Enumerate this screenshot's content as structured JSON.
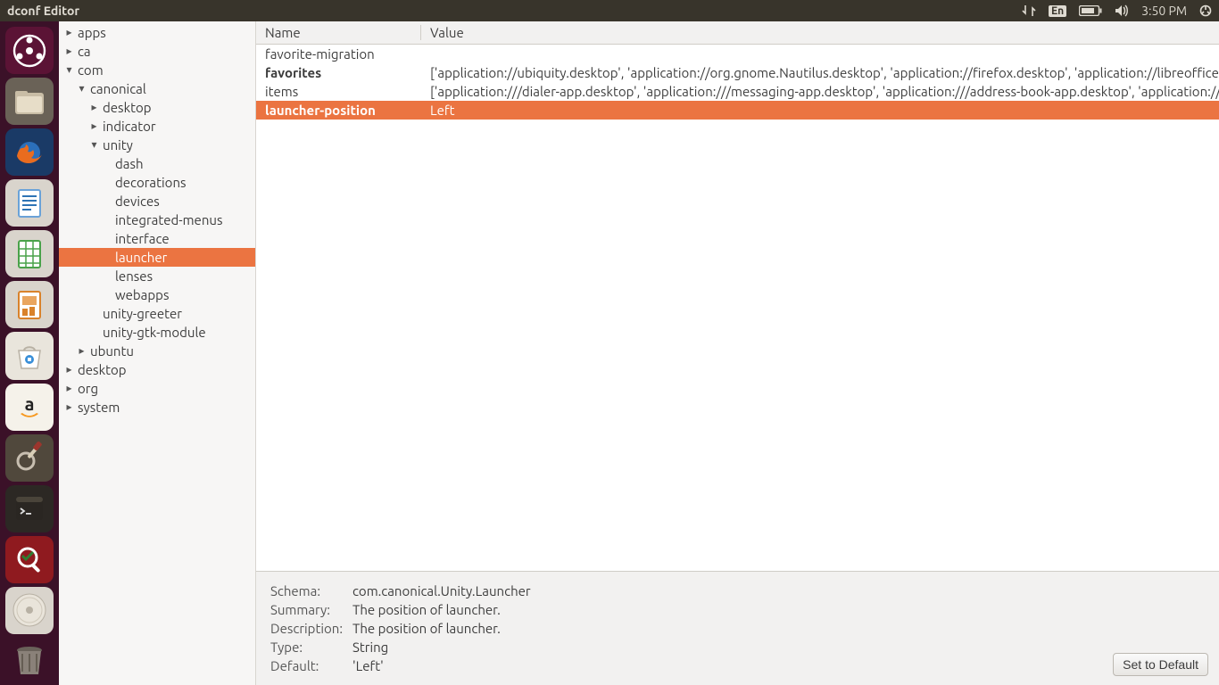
{
  "menubar": {
    "title": "dconf Editor",
    "lang": "En",
    "time": "3:50 PM"
  },
  "launcher_items": [
    {
      "name": "dash",
      "bg": "#5b1335"
    },
    {
      "name": "files",
      "bg": "#6a6257"
    },
    {
      "name": "firefox",
      "bg": "#1a3a66"
    },
    {
      "name": "writer",
      "bg": "#d9d4cc"
    },
    {
      "name": "calc",
      "bg": "#d9d4cc"
    },
    {
      "name": "impress",
      "bg": "#d9d4cc"
    },
    {
      "name": "software",
      "bg": "#e9e5dc"
    },
    {
      "name": "amazon",
      "bg": "#f5f2ea"
    },
    {
      "name": "settings",
      "bg": "#50483c"
    },
    {
      "name": "terminal",
      "bg": "#2c2824"
    },
    {
      "name": "dconf",
      "bg": "#8f1a1f"
    },
    {
      "name": "disk",
      "bg": "#d9d4cc"
    },
    {
      "name": "trash",
      "bg": "transparent"
    }
  ],
  "tree": [
    {
      "depth": 0,
      "exp": "right",
      "label": "apps"
    },
    {
      "depth": 0,
      "exp": "right",
      "label": "ca"
    },
    {
      "depth": 0,
      "exp": "down",
      "label": "com"
    },
    {
      "depth": 1,
      "exp": "down",
      "label": "canonical"
    },
    {
      "depth": 2,
      "exp": "right",
      "label": "desktop"
    },
    {
      "depth": 2,
      "exp": "right",
      "label": "indicator"
    },
    {
      "depth": 2,
      "exp": "down",
      "label": "unity"
    },
    {
      "depth": 3,
      "exp": "none",
      "label": "dash"
    },
    {
      "depth": 3,
      "exp": "none",
      "label": "decorations"
    },
    {
      "depth": 3,
      "exp": "none",
      "label": "devices"
    },
    {
      "depth": 3,
      "exp": "none",
      "label": "integrated-menus"
    },
    {
      "depth": 3,
      "exp": "none",
      "label": "interface"
    },
    {
      "depth": 3,
      "exp": "none",
      "label": "launcher",
      "sel": true
    },
    {
      "depth": 3,
      "exp": "none",
      "label": "lenses"
    },
    {
      "depth": 3,
      "exp": "none",
      "label": "webapps"
    },
    {
      "depth": 2,
      "exp": "none",
      "label": "unity-greeter"
    },
    {
      "depth": 2,
      "exp": "none",
      "label": "unity-gtk-module"
    },
    {
      "depth": 1,
      "exp": "right",
      "label": "ubuntu"
    },
    {
      "depth": 0,
      "exp": "right",
      "label": "desktop"
    },
    {
      "depth": 0,
      "exp": "right",
      "label": "org"
    },
    {
      "depth": 0,
      "exp": "right",
      "label": "system"
    }
  ],
  "columns": {
    "name": "Name",
    "value": "Value"
  },
  "rows": [
    {
      "name": "favorite-migration",
      "value": "",
      "bold": false
    },
    {
      "name": "favorites",
      "value": "['application://ubiquity.desktop', 'application://org.gnome.Nautilus.desktop', 'application://firefox.desktop', 'application://libreoffice-writer.desktop', ...]",
      "bold": true
    },
    {
      "name": "items",
      "value": "['application:///dialer-app.desktop', 'application:///messaging-app.desktop', 'application:///address-book-app.desktop', 'application:///...",
      "bold": false
    },
    {
      "name": "launcher-position",
      "value": "Left",
      "bold": true,
      "sel": true
    }
  ],
  "detail": {
    "schema_label": "Schema:",
    "schema": "com.canonical.Unity.Launcher",
    "summary_label": "Summary:",
    "summary": "The position of launcher.",
    "description_label": "Description:",
    "description": "The position of launcher.",
    "type_label": "Type:",
    "type": "String",
    "default_label": "Default:",
    "default": "'Left'",
    "set_default": "Set to Default"
  }
}
